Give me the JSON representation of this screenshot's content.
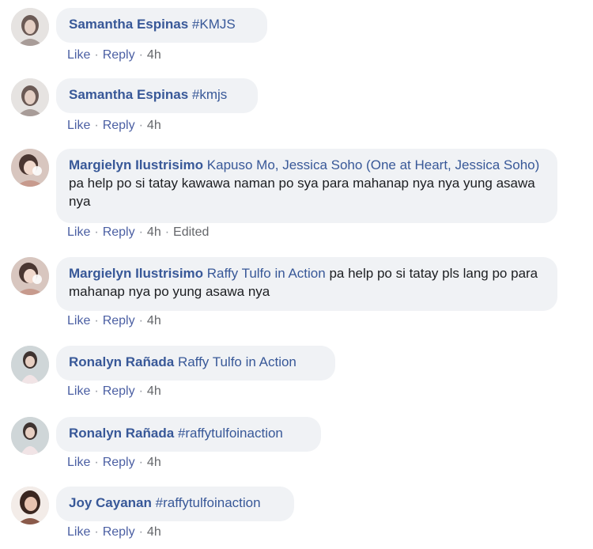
{
  "comments": [
    {
      "author": "Samantha Espinas",
      "mention": "#KMJS",
      "text": "",
      "actions": {
        "like": "Like",
        "reply": "Reply",
        "time": "4h",
        "edited": ""
      },
      "avatar_color": "#b8a9a3"
    },
    {
      "author": "Samantha Espinas",
      "mention": "#kmjs",
      "text": "",
      "actions": {
        "like": "Like",
        "reply": "Reply",
        "time": "4h",
        "edited": ""
      },
      "avatar_color": "#b8a9a3"
    },
    {
      "author": "Margielyn Ilustrisimo",
      "mention": "Kapuso Mo, Jessica Soho (One at Heart, Jessica Soho)",
      "text": "pa help po si tatay kawawa naman po sya para mahanap nya nya yung asawa nya",
      "actions": {
        "like": "Like",
        "reply": "Reply",
        "time": "4h",
        "edited": "Edited"
      },
      "avatar_color": "#c79a8d"
    },
    {
      "author": "Margielyn Ilustrisimo",
      "mention": "Raffy Tulfo in Action",
      "text": "pa help po si tatay pls lang po para mahanap nya po yung asawa nya",
      "actions": {
        "like": "Like",
        "reply": "Reply",
        "time": "4h",
        "edited": ""
      },
      "avatar_color": "#c79a8d"
    },
    {
      "author": "Ronalyn Rañada",
      "mention": "Raffy Tulfo in Action",
      "text": "",
      "actions": {
        "like": "Like",
        "reply": "Reply",
        "time": "4h",
        "edited": ""
      },
      "avatar_color": "#9aa3a8"
    },
    {
      "author": "Ronalyn Rañada",
      "mention": "#raffytulfoinaction",
      "text": "",
      "actions": {
        "like": "Like",
        "reply": "Reply",
        "time": "4h",
        "edited": ""
      },
      "avatar_color": "#9aa3a8"
    },
    {
      "author": "Joy Cayanan",
      "mention": "#raffytulfoinaction",
      "text": "",
      "actions": {
        "like": "Like",
        "reply": "Reply",
        "time": "4h",
        "edited": ""
      },
      "avatar_color": "#8a5a4a"
    }
  ],
  "colors": {
    "link_blue": "#385898",
    "bubble_bg": "#f0f2f5",
    "meta_gray": "#65676b"
  },
  "icons": {
    "avatar": "profile-photo"
  }
}
